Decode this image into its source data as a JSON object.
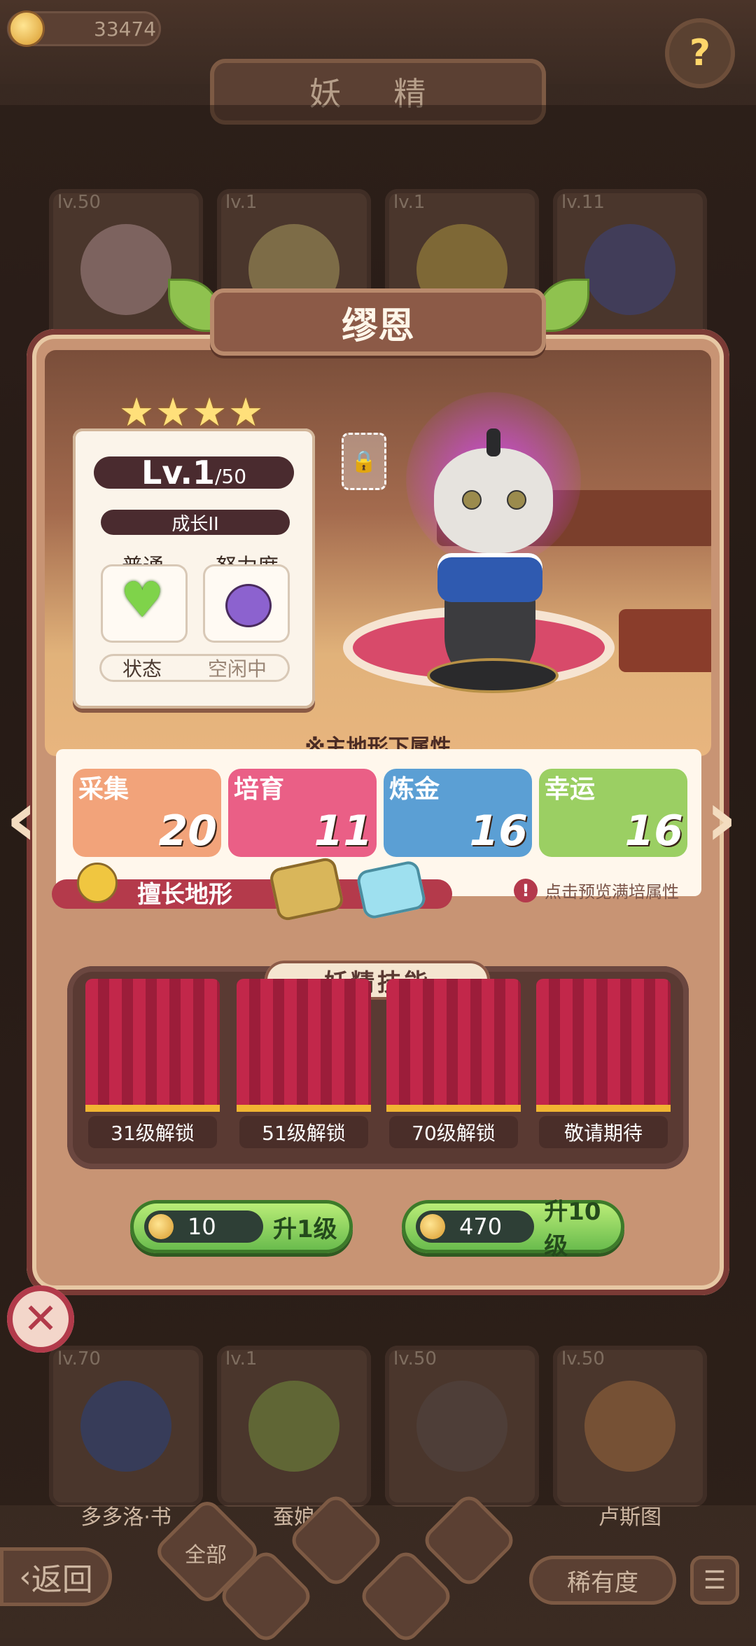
{
  "header": {
    "coins": "33474",
    "title": "妖 精",
    "help_icon": "question-sprout-icon"
  },
  "background_cards": {
    "top": [
      {
        "level": "lv.50"
      },
      {
        "level": "lv.1"
      },
      {
        "level": "lv.1"
      },
      {
        "level": "lv.11"
      }
    ],
    "bottom": [
      {
        "level": "lv.70",
        "name": "多多洛·书"
      },
      {
        "level": "lv.1",
        "name": "蚕娘"
      },
      {
        "level": "lv.50",
        "name": "拉"
      },
      {
        "level": "lv.50",
        "name": "卢斯图"
      }
    ]
  },
  "fairy": {
    "name": "缪恩",
    "stars": 4,
    "level_main": "Lv.1",
    "level_max": "/50",
    "growth": "成长II",
    "rarity_label": "普通",
    "effort_label": "努力度",
    "state_label": "状态",
    "state_value": "空闲中"
  },
  "attributes": {
    "title": "※主地形下属性",
    "items": [
      {
        "label": "采集",
        "value": "20",
        "color": "#f2a37a"
      },
      {
        "label": "培育",
        "value": "11",
        "color": "#ea5f86"
      },
      {
        "label": "炼金",
        "value": "16",
        "color": "#5b9fd4"
      },
      {
        "label": "幸运",
        "value": "16",
        "color": "#9bcf63"
      }
    ],
    "terrain_label": "擅长地形",
    "terrain_main_tag": "主",
    "terrain_sub_tag": "副",
    "preview_hint": "点击预览满培属性"
  },
  "skills": {
    "title": "妖精技能",
    "slots": [
      "31级解锁",
      "51级解锁",
      "70级解锁",
      "敬请期待"
    ]
  },
  "upgrade": {
    "one": {
      "cost": "10",
      "label": "升1级"
    },
    "ten": {
      "cost": "470",
      "label": "升10级"
    }
  },
  "bottom": {
    "back": "返回",
    "filter_all": "全部",
    "rarity": "稀有度"
  }
}
